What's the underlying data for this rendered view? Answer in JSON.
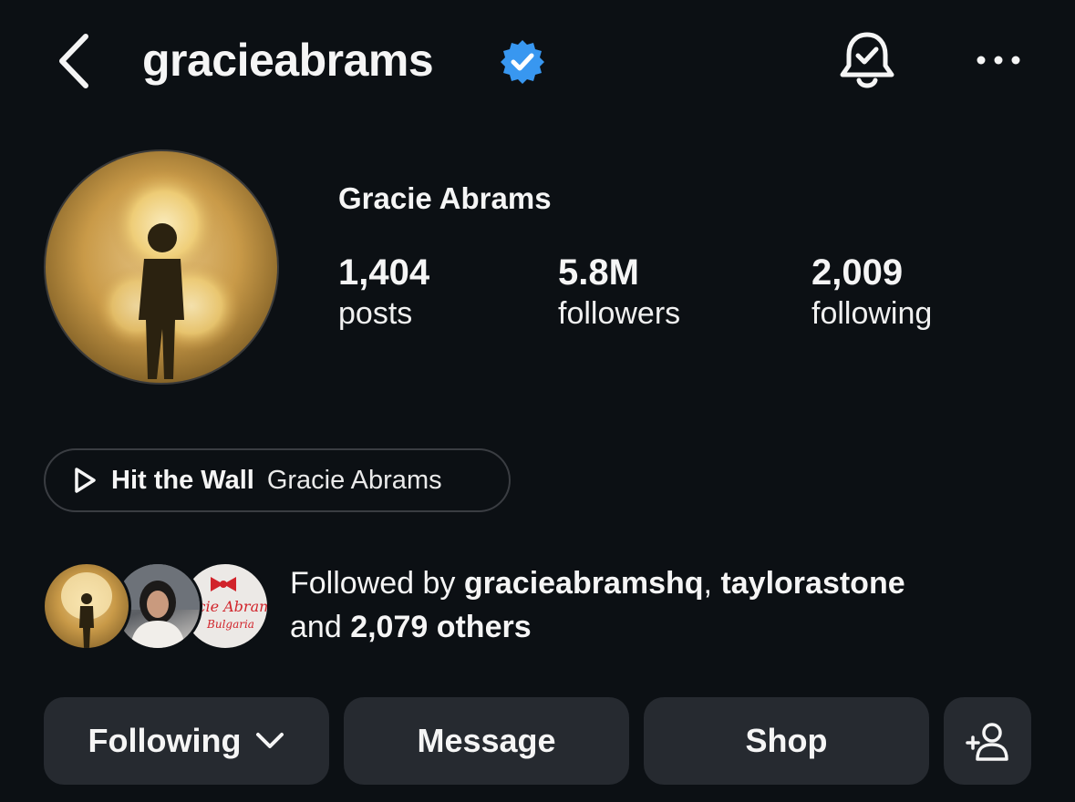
{
  "header": {
    "username": "gracieabrams",
    "verified": true,
    "icons": [
      "chevron-left-icon",
      "verified-badge-icon",
      "bell-check-icon",
      "more-horizontal-icon"
    ]
  },
  "profile": {
    "display_name": "Gracie Abrams",
    "stats": [
      {
        "value": "1,404",
        "label": "posts"
      },
      {
        "value": "5.8M",
        "label": "followers"
      },
      {
        "value": "2,009",
        "label": "following"
      }
    ]
  },
  "music": {
    "title": "Hit the Wall",
    "artist": "Gracie Abrams",
    "icon": "play-icon"
  },
  "followed_by": {
    "prefix": "Followed by ",
    "user1": "gracieabramshq",
    "separator": ", ",
    "user2": "taylorastone",
    "and": "and ",
    "others": "2,079 others",
    "third_avatar_text": "Gracie Abrams",
    "third_avatar_sub": "Bulgaria"
  },
  "actions": {
    "following_label": "Following",
    "message_label": "Message",
    "shop_label": "Shop",
    "add_icon": "add-person-icon"
  },
  "colors": {
    "background": "#0c1014",
    "button": "#262a30",
    "verified": "#3897f0",
    "text": "#f5f5f5"
  }
}
